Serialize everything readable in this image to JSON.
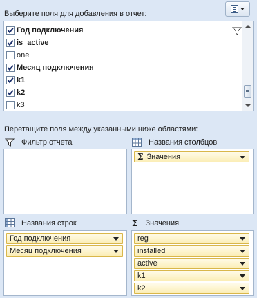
{
  "header": {
    "label": "Выберите поля для добавления в отчет:"
  },
  "fields": [
    {
      "name": "Год подключения",
      "checked": true,
      "bold": true
    },
    {
      "name": "is_active",
      "checked": true,
      "bold": true
    },
    {
      "name": "one",
      "checked": false,
      "bold": false
    },
    {
      "name": "Месяц подключения",
      "checked": true,
      "bold": true
    },
    {
      "name": "k1",
      "checked": true,
      "bold": true
    },
    {
      "name": "k2",
      "checked": true,
      "bold": true
    },
    {
      "name": "k3",
      "checked": false,
      "bold": false
    }
  ],
  "hint": "Перетащите поля между указанными ниже областями:",
  "areas": {
    "filter": {
      "title": "Фильтр отчета",
      "icon": "filter-icon",
      "items": []
    },
    "columns": {
      "title": "Названия столбцов",
      "icon": "column-table-icon",
      "items": [
        "Значения"
      ]
    },
    "rows": {
      "title": "Названия строк",
      "icon": "row-table-icon",
      "items": [
        "Год подключения",
        "Месяц подключения"
      ]
    },
    "values": {
      "title": "Значения",
      "icon": "sigma-icon",
      "items": [
        "reg",
        "installed",
        "active",
        "k1",
        "k2"
      ]
    }
  },
  "colors": {
    "panel_bg": "#dce7f5",
    "chip_border": "#d9b74a",
    "chip_fill": "#fbeeb6"
  }
}
